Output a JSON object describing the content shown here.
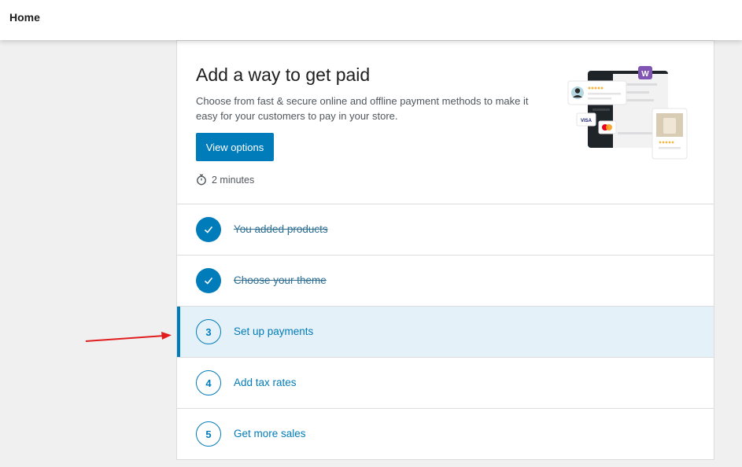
{
  "header": {
    "title": "Home"
  },
  "hero": {
    "title": "Add a way to get paid",
    "description": "Choose from fast & secure online and offline payment methods to make it easy for your customers to pay in your store.",
    "button_label": "View options",
    "time_estimate": "2 minutes",
    "time_icon": "stopwatch-icon",
    "illustration": {
      "badge_letter": "W",
      "card_brand": "VISA",
      "accent": "#7f54b3"
    }
  },
  "tasks": [
    {
      "number": "",
      "label": "You added products",
      "completed": true,
      "active": false
    },
    {
      "number": "",
      "label": "Choose your theme",
      "completed": true,
      "active": false
    },
    {
      "number": "3",
      "label": "Set up payments",
      "completed": false,
      "active": true
    },
    {
      "number": "4",
      "label": "Add tax rates",
      "completed": false,
      "active": false
    },
    {
      "number": "5",
      "label": "Get more sales",
      "completed": false,
      "active": false
    }
  ],
  "colors": {
    "primary": "#007cba",
    "active_bg": "#e5f1f8",
    "annotation_arrow": "#e11d1d"
  }
}
